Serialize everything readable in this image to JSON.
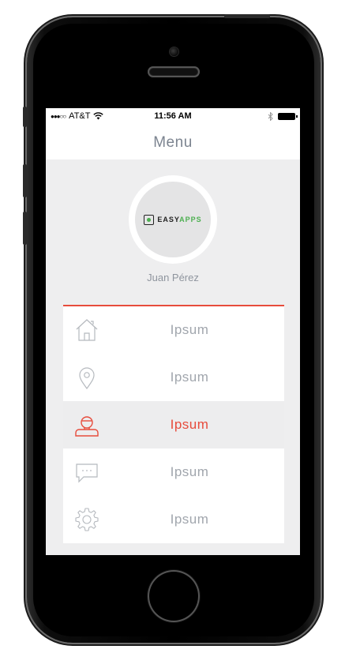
{
  "status_bar": {
    "signal": "●●●○○",
    "carrier": "AT&T",
    "wifi_icon": "wifi-icon",
    "time": "11:56 AM",
    "bluetooth_icon": "bluetooth-icon",
    "battery_icon": "battery-icon"
  },
  "nav": {
    "title": "Menu"
  },
  "profile": {
    "logo_prefix": "EASY",
    "logo_accent": "APPS",
    "name": "Juan Pérez"
  },
  "menu": {
    "items": [
      {
        "label": "Ipsum",
        "icon": "home-icon",
        "active": false
      },
      {
        "label": "Ipsum",
        "icon": "location-pin-icon",
        "active": false
      },
      {
        "label": "Ipsum",
        "icon": "user-icon",
        "active": true
      },
      {
        "label": "Ipsum",
        "icon": "chat-icon",
        "active": false
      },
      {
        "label": "Ipsum",
        "icon": "gear-icon",
        "active": false
      }
    ]
  },
  "colors": {
    "accent": "#e74c3c",
    "inactive": "#a1a6ad",
    "logo_green": "#4caf50"
  }
}
